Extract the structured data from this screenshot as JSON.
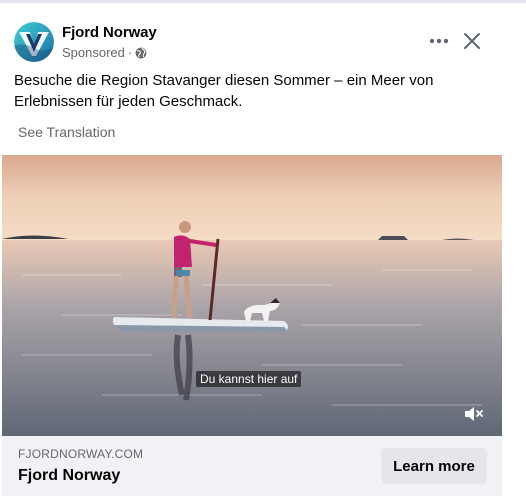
{
  "post": {
    "page_name": "Fjord Norway",
    "sponsored_label": "Sponsored",
    "separator": "·",
    "audience_icon": "globe-icon",
    "body_text": "Besuche die Region Stavanger diesen Sommer – ein Meer von Erlebnissen für jeden Geschmack.",
    "see_translation": "See Translation"
  },
  "header_actions": {
    "more_icon": "more-dots-icon",
    "close_icon": "close-icon"
  },
  "video": {
    "subtitle": "Du kannst hier auf",
    "mute_icon": "muted-speaker-icon"
  },
  "cta": {
    "domain": "FJORDNORWAY.COM",
    "title": "Fjord Norway",
    "button_label": "Learn more"
  },
  "colors": {
    "text_primary": "#050505",
    "text_secondary": "#65676b",
    "cta_background": "#f0f2f5",
    "button_background": "#e4e6eb",
    "logo_teal": "#2bb3c4",
    "logo_navy": "#1b3a6b"
  }
}
